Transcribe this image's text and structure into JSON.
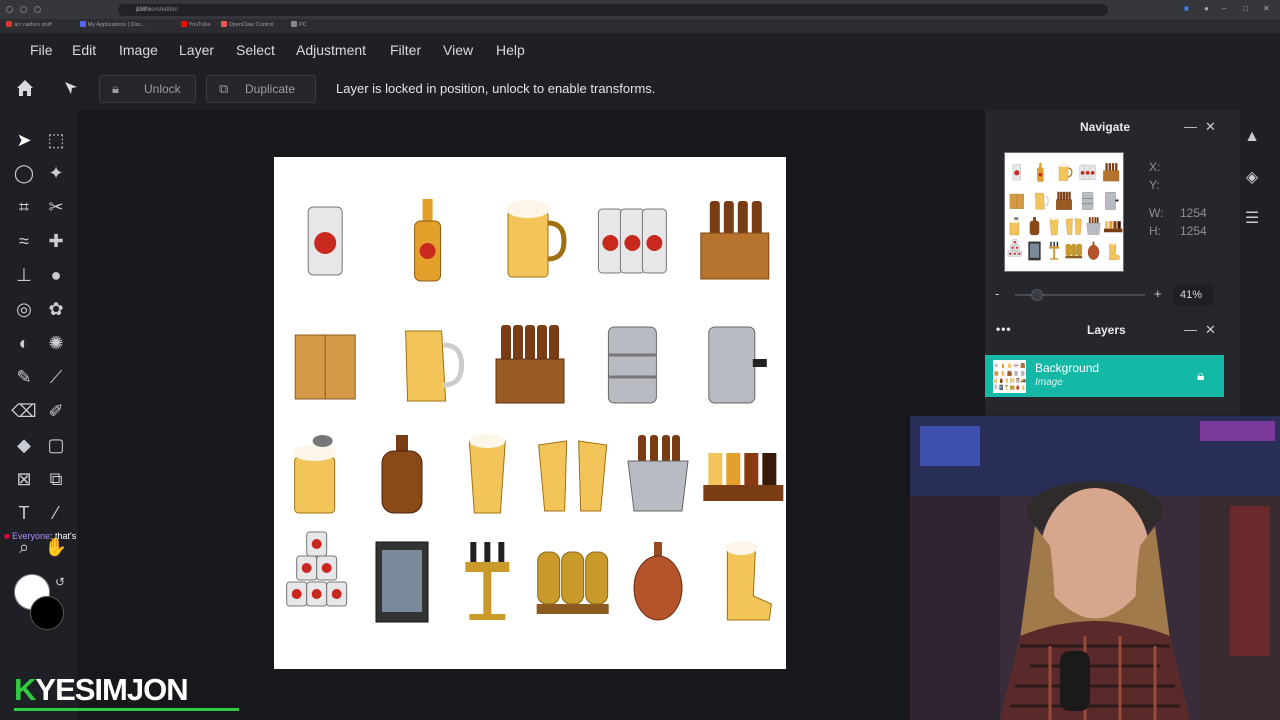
{
  "browser": {
    "url": "pixlr.com/editor/",
    "zoom": "100%",
    "bookmarks": [
      {
        "label": "arc raiders stuff",
        "color": "#d33"
      },
      {
        "label": "My Applications | Disc...",
        "color": "#5865f2"
      },
      {
        "label": "YouTube",
        "color": "#f00"
      },
      {
        "label": "OpenClaw Control",
        "color": "#e55"
      },
      {
        "label": "PC",
        "color": "#888"
      }
    ]
  },
  "menu": [
    "File",
    "Edit",
    "Image",
    "Layer",
    "Select",
    "Adjustment",
    "Filter",
    "View",
    "Help"
  ],
  "options_bar": {
    "unlock_label": "Unlock",
    "duplicate_label": "Duplicate",
    "message": "Layer is locked in position, unlock to enable transforms."
  },
  "navigate": {
    "title": "Navigate",
    "x_label": "X:",
    "y_label": "Y:",
    "w_label": "W:",
    "w_value": "1254",
    "h_label": "H:",
    "h_value": "1254",
    "zoom": "41%",
    "zoom_fraction": 0.41,
    "zoom_minus": "-",
    "zoom_plus": "+"
  },
  "layers": {
    "title": "Layers",
    "menu_dots": "•••",
    "items": [
      {
        "name": "Background",
        "type": "Image",
        "locked": true
      }
    ]
  },
  "chat": {
    "who": "Everyone",
    "message": ": that's the grift"
  },
  "overlay_logo": "YESIMJON",
  "colors": {
    "accent": "#14b8a6",
    "foreground": "#ffffff",
    "background": "#000000"
  },
  "canvas_items": [
    [
      "beer-can",
      "beer-bottle",
      "beer-mug",
      "six-pack-cans",
      "bottle-crate"
    ],
    [
      "cardboard-box",
      "beer-pitcher",
      "wooden-bottle-crate",
      "steel-keg",
      "keg-with-tap"
    ],
    [
      "stein-with-lid",
      "growler",
      "pint-glass",
      "toasting-glasses",
      "ice-bucket",
      "beer-flight"
    ],
    [
      "stacked-cans",
      "beer-fridge",
      "beer-tap-tower",
      "brewing-tanks",
      "copper-still",
      "beer-boot"
    ]
  ]
}
